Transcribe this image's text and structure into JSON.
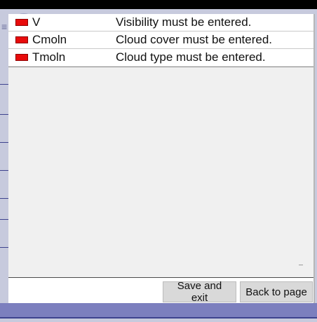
{
  "dialog": {
    "errors": [
      {
        "code": "V",
        "message": "Visibility must be entered."
      },
      {
        "code": "Cmoln",
        "message": "Cloud cover must be entered."
      },
      {
        "code": "Tmoln",
        "message": "Cloud type must be entered."
      }
    ],
    "footer": {
      "save_label": "Save and exit",
      "back_label": "Back to page"
    }
  },
  "colors": {
    "flag": "#e80b0b",
    "background_app": "#c7cadd",
    "accent_band": "#7c7fbe"
  },
  "icons": {
    "error_flag": "red-flag-icon",
    "menu": "menu-icon"
  }
}
